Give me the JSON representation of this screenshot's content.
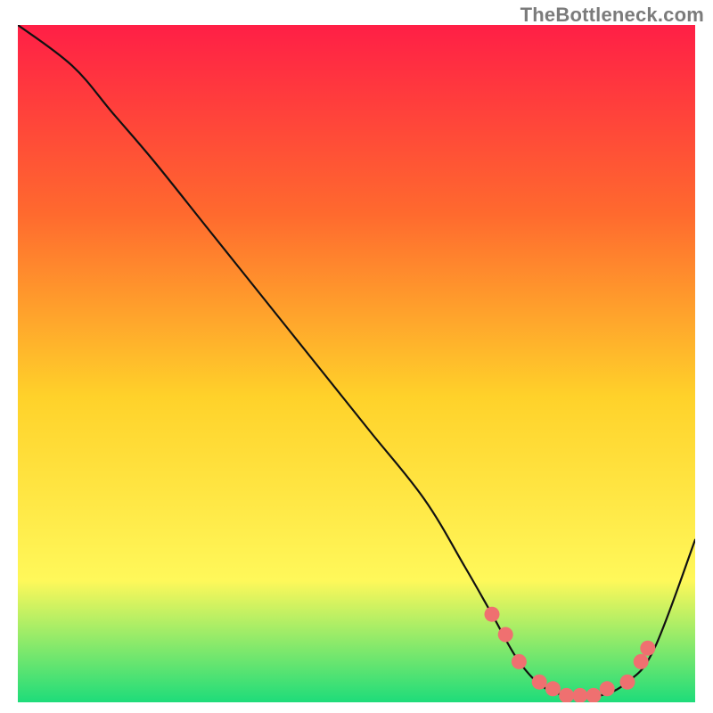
{
  "watermark": {
    "text": "TheBottleneck.com"
  },
  "colors": {
    "gradient_top": "#ff1f46",
    "gradient_mid_upper": "#ff6a2e",
    "gradient_mid": "#ffd22a",
    "gradient_mid_lower": "#fff85a",
    "gradient_bottom": "#1edc7a",
    "curve": "#111111",
    "dot": "#ef7070"
  },
  "chart_data": {
    "type": "line",
    "title": "",
    "xlabel": "",
    "ylabel": "",
    "xlim": [
      0,
      100
    ],
    "ylim": [
      0,
      100
    ],
    "grid": false,
    "legend": false,
    "series": [
      {
        "name": "bottleneck-curve",
        "x": [
          0,
          8,
          14,
          20,
          28,
          36,
          44,
          52,
          60,
          66,
          70,
          74,
          78,
          82,
          86,
          90,
          94,
          100
        ],
        "y": [
          100,
          94,
          87,
          80,
          70,
          60,
          50,
          40,
          30,
          20,
          13,
          6,
          2,
          1,
          1,
          3,
          8,
          24
        ]
      }
    ],
    "highlight_points": {
      "name": "highlighted-range",
      "x": [
        70,
        72,
        74,
        77,
        79,
        81,
        83,
        85,
        87,
        90,
        92,
        93
      ],
      "y": [
        13,
        10,
        6,
        3,
        2,
        1,
        1,
        1,
        2,
        3,
        6,
        8
      ]
    }
  }
}
